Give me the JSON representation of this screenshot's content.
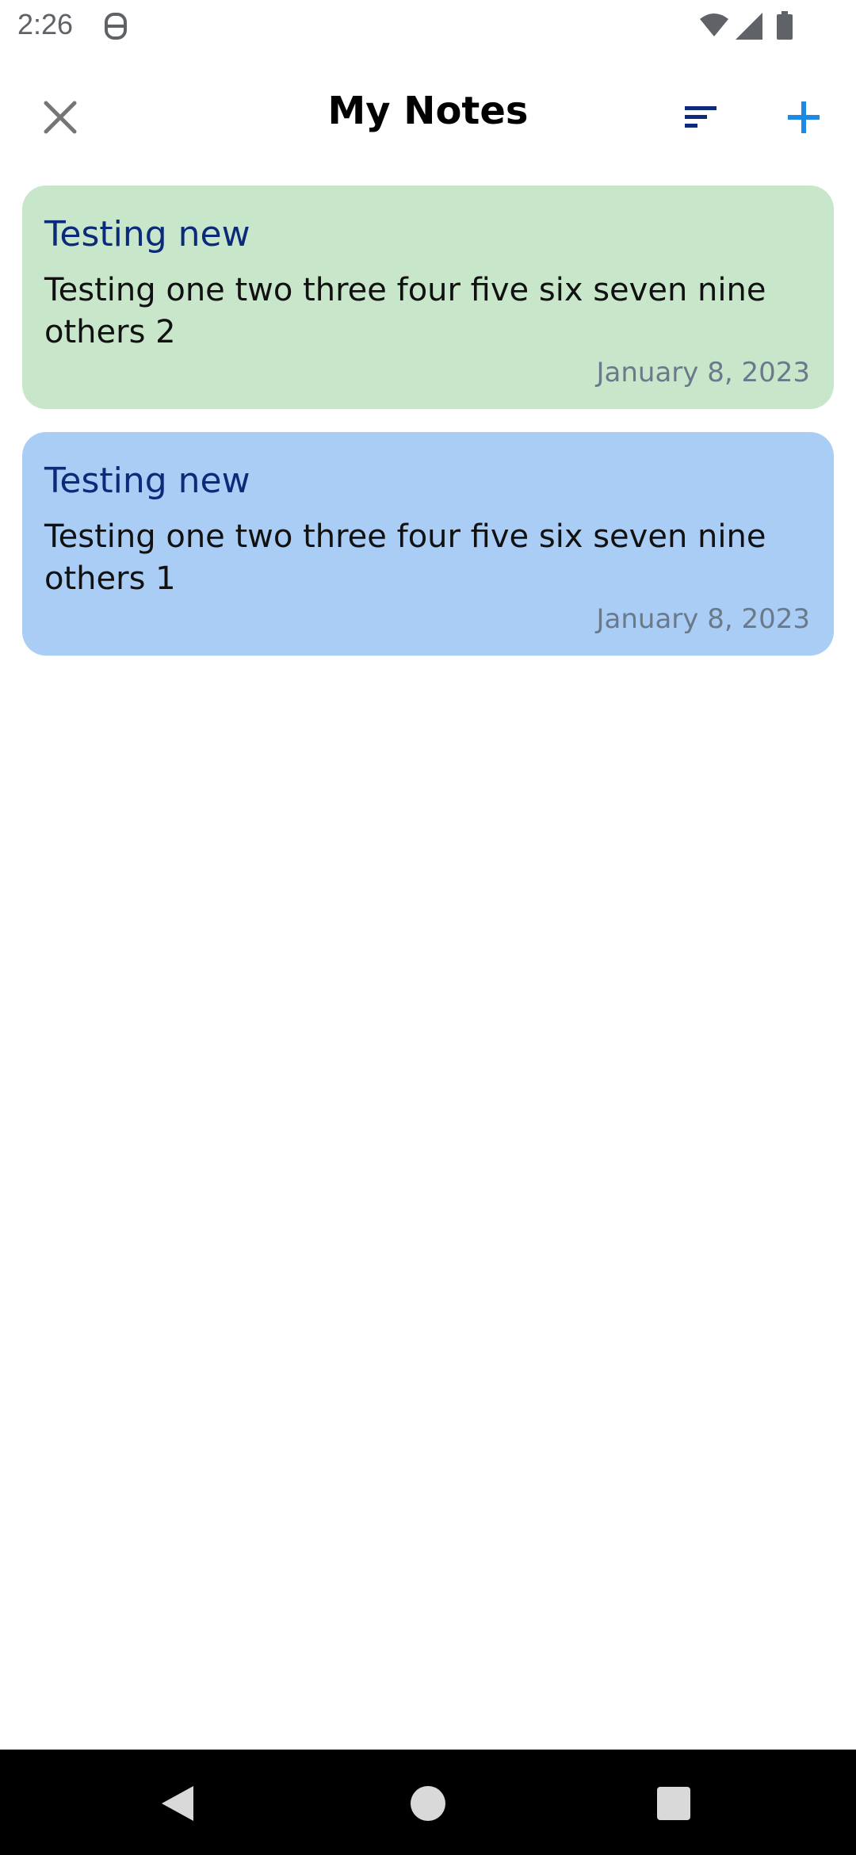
{
  "status_bar": {
    "time": "2:26",
    "icons": [
      "app-notification-icon",
      "wifi-icon",
      "signal-icon",
      "battery-icon"
    ]
  },
  "app_bar": {
    "title": "My Notes",
    "close_icon": "close-icon",
    "sort_icon": "sort-icon",
    "add_icon": "add-icon",
    "colors": {
      "close": "#757575",
      "sort": "#0d2b7a",
      "add": "#1e88e5"
    }
  },
  "notes": [
    {
      "title": "Testing new",
      "body": "Testing one two three four five six seven nine others 2",
      "date": "January 8, 2023",
      "color": "#c8e6c9"
    },
    {
      "title": "Testing new",
      "body": "Testing one two three four five six seven nine others 1",
      "date": "January 8, 2023",
      "color": "#aacdf5"
    }
  ],
  "nav_bar": {
    "icons": [
      "back-icon",
      "home-icon",
      "recents-icon"
    ]
  }
}
